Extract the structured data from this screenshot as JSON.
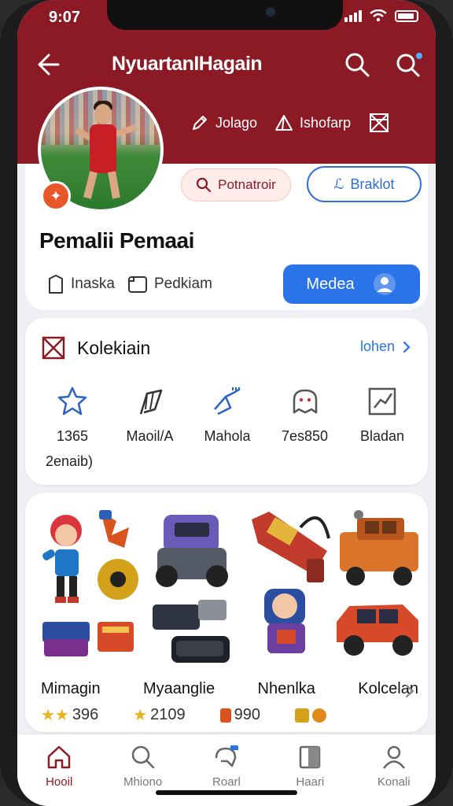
{
  "status": {
    "time": "9:07"
  },
  "header": {
    "title": "NyuartanIHagain",
    "actions": [
      {
        "label": "Jolago",
        "icon": "pencil-icon"
      },
      {
        "label": "Ishofarp",
        "icon": "triangle-icon"
      },
      {
        "label": "",
        "icon": "bookmark-icon"
      }
    ]
  },
  "profile": {
    "name": "Pemalii Pemaai",
    "search_chip": "Potnatroir",
    "outline_chip": "Braklot",
    "meta": [
      {
        "label": "Inaska",
        "icon": "door-icon"
      },
      {
        "label": "Pedkiam",
        "icon": "card-icon"
      }
    ],
    "primary_button": "Medea"
  },
  "collection": {
    "title": "Kolekiain",
    "link": "lohen",
    "categories": [
      {
        "label": "1365",
        "icon": "star-badge-icon"
      },
      {
        "label": "Maoil/A",
        "icon": "flag-icon"
      },
      {
        "label": "Mahola",
        "icon": "bird-icon"
      },
      {
        "label": "7es850",
        "icon": "ghost-icon"
      },
      {
        "label": "Bladan",
        "icon": "chart-icon"
      }
    ],
    "sub_label": "2enaib)"
  },
  "items": {
    "names": [
      "Mimagin",
      "Myaanglie",
      "Nhenlka",
      "Kolcelan"
    ],
    "prices": [
      "396",
      "2109",
      "990"
    ]
  },
  "tabs": [
    {
      "label": "Hooil",
      "icon": "home-icon",
      "active": true
    },
    {
      "label": "Mhiono",
      "icon": "search-icon",
      "active": false
    },
    {
      "label": "Roarl",
      "icon": "chat-icon",
      "active": false
    },
    {
      "label": "Haari",
      "icon": "book-icon",
      "active": false
    },
    {
      "label": "Konali",
      "icon": "person-icon",
      "active": false
    }
  ],
  "colors": {
    "brand": "#8b1a24",
    "accent": "#2a73e8"
  }
}
